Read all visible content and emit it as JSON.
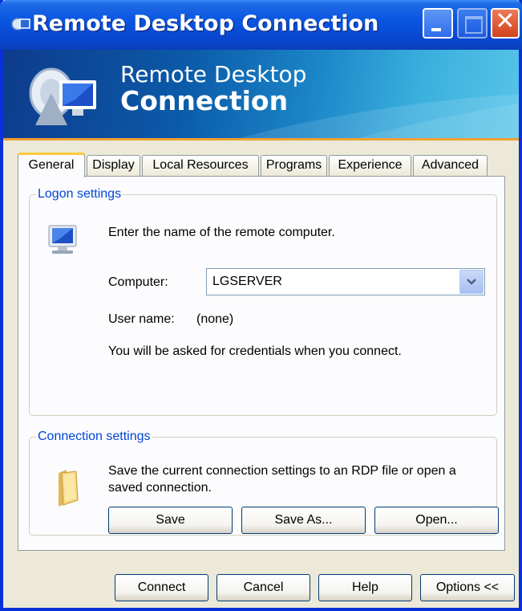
{
  "window": {
    "title": "Remote Desktop Connection",
    "banner_line1": "Remote Desktop",
    "banner_line2": "Connection",
    "minimize_icon": "minimize-icon",
    "maximize_icon": "maximize-icon",
    "close_icon": "close-icon"
  },
  "tabs": [
    {
      "label": "General",
      "active": true
    },
    {
      "label": "Display"
    },
    {
      "label": "Local Resources"
    },
    {
      "label": "Programs"
    },
    {
      "label": "Experience"
    },
    {
      "label": "Advanced"
    }
  ],
  "logon": {
    "legend": "Logon settings",
    "prompt": "Enter the name of the remote computer.",
    "computer_label": "Computer:",
    "computer_value": "LGSERVER",
    "username_label": "User name:",
    "username_value": "(none)",
    "credentials_note": "You will be asked for credentials when you connect."
  },
  "connection": {
    "legend": "Connection settings",
    "description_line1": "Save the current connection settings to an RDP file or open a",
    "description_line2": "saved connection.",
    "save_label": "Save",
    "save_as_label": "Save As...",
    "open_label": "Open..."
  },
  "footer": {
    "connect_label": "Connect",
    "cancel_label": "Cancel",
    "help_label": "Help",
    "options_label": "Options <<"
  },
  "colors": {
    "titlebar": "#0a56e0",
    "legend_text": "#0046d5",
    "active_tab_accent": "#ffc83c",
    "close_button": "#d1431b",
    "dialog_face": "#ece9d8"
  }
}
